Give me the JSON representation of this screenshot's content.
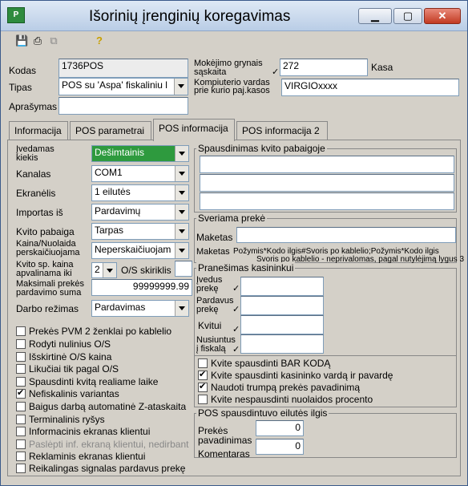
{
  "window": {
    "title": "Išorinių įrenginių koregavimas",
    "icon_text": "P"
  },
  "toolbar": {
    "save_icon": "save-icon",
    "print_icon": "print-icon",
    "copy_icon": "copy-icon",
    "help_icon": "help-icon"
  },
  "header": {
    "kodas_label": "Kodas",
    "kodas_value": "1736POS",
    "tipas_label": "Tipas",
    "tipas_value": "POS su 'Aspa' fiskaliniu l",
    "aprasymas_label": "Aprašymas",
    "aprasymas_value": "",
    "mokejimo_label_1": "Mokėjimo grynais",
    "mokejimo_label_2": "sąskaita",
    "mokejimo_value": "272",
    "mokejimo_suffix": "Kasa",
    "komp_label_1": "Kompiuterio vardas",
    "komp_label_2": "prie kurio paj.kasos",
    "komp_value": "VIRGIOxxxx"
  },
  "tabs": [
    "Informacija",
    "POS parametrai",
    "POS informacija",
    "POS informacija 2"
  ],
  "left": {
    "ivedamas_label_1": "Įvedamas",
    "ivedamas_label_2": "kiekis",
    "ivedamas_value": "Dešimtainis",
    "kanalas_label": "Kanalas",
    "kanalas_value": "COM1",
    "ekranelis_label": "Ekranėlis",
    "ekranelis_value": "1 eilutės",
    "importas_label": "Importas iš",
    "importas_value": "Pardavimų",
    "kvito_pab_label": "Kvito pabaiga",
    "kvito_pab_value": "Tarpas",
    "kaina_label_1": "Kaina/Nuolaida",
    "kaina_label_2": "perskaičiuojama",
    "kaina_value": "Neperskaičiuojam",
    "kvito_sp_label_1": "Kvito sp. kaina",
    "kvito_sp_label_2": "apvalinama iki",
    "kvito_sp_value": "2",
    "os_label": "O/S skiriklis",
    "maks_label_1": "Maksimali prekės",
    "maks_label_2": "pardavimo suma",
    "maks_value": "99999999.99",
    "darbo_label": "Darbo režimas",
    "darbo_value": "Pardavimas"
  },
  "checkboxes_left": [
    {
      "label": "Prekės PVM 2 ženklai  po kablelio",
      "checked": false,
      "disabled": false
    },
    {
      "label": "Rodyti nulinius O/S",
      "checked": false,
      "disabled": false
    },
    {
      "label": "Išskirtinė O/S kaina",
      "checked": false,
      "disabled": false
    },
    {
      "label": "Likučiai tik pagal O/S",
      "checked": false,
      "disabled": false
    },
    {
      "label": "Spausdinti kvitą realiame laike",
      "checked": false,
      "disabled": false
    },
    {
      "label": "Nefiskalinis variantas",
      "checked": true,
      "disabled": false
    },
    {
      "label": "Baigus darbą automatinė Z-ataskaita",
      "checked": false,
      "disabled": false
    },
    {
      "label": "Terminalinis ryšys",
      "checked": false,
      "disabled": false
    },
    {
      "label": "Informacinis ekranas klientui",
      "checked": false,
      "disabled": false
    },
    {
      "label": "Paslėpti inf. ekraną klientui, nedirbant",
      "checked": false,
      "disabled": true
    },
    {
      "label": "Reklaminis ekranas klientui",
      "checked": false,
      "disabled": false
    },
    {
      "label": "Reikalingas signalas pardavus prekę",
      "checked": false,
      "disabled": false
    }
  ],
  "right": {
    "spausdinimas_title": "Spausdinimas kvito pabaigoje",
    "sveriama_title": "Sveriama prekė",
    "maketas_label": "Maketas",
    "maketas2_label": "Maketas",
    "maketas2_text_1": "Požymis*Kodo ilgis#Svoris po kablelio;Požymis*Kodo ilgis",
    "maketas2_text_2": "Svoris po kablelio - neprivalomas, pagal nutylėjimą lygus 3",
    "pranesimas_title": "Pranešimas kasininkui",
    "ivedus_1": "Įvedus",
    "ivedus_2": "prekę",
    "pardavus_1": "Pardavus",
    "pardavus_2": "prekę",
    "kvitui": "Kvitui",
    "nusiuntus_1": "Nusiuntus",
    "nusiuntus_2": "į fiskalą",
    "pos_title": "POS spausdintuvo eilutės ilgis",
    "prekes_1": "Prekės",
    "prekes_2": "pavadinimas",
    "prekes_value": "0",
    "komentaras": "Komentaras",
    "komentaras_value": "0"
  },
  "checkboxes_right": [
    {
      "label": "Kvite spausdinti BAR KODĄ",
      "checked": false
    },
    {
      "label": "Kvite spausdinti kasininko vardą ir pavardę",
      "checked": true
    },
    {
      "label": "Naudoti trumpą prekės pavadinimą",
      "checked": true
    },
    {
      "label": "Kvite nespausdinti nuolaidos procento",
      "checked": false
    }
  ]
}
